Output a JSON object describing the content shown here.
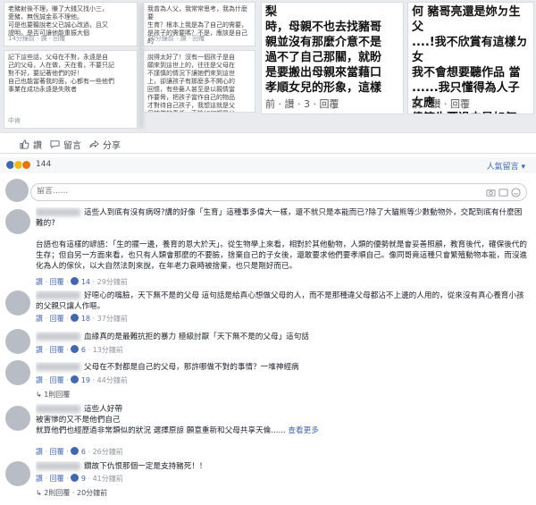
{
  "collage": {
    "tile1": {
      "text": "老豬射後不理，賺了大錢又找小三，\n愛豬，無恆誠金系不理他。\n可是也要聽說老父已誠心改過，且又\n證明，是否可讓他能重振大個",
      "footer": "14分鐘前 · 讚 · 回覆"
    },
    "tile2": {
      "text": "我曾為人父，我常常思考，我為什麼要\n生育？根本上我是為了自己的需要，\n是孩子的需要嗎？不是，應該是自己的\n需要，所以我對上一代的付出，我對我的\n家庭我要負的責任，我擔當著，所以我\n對自己的家庭子女的回報。",
      "footer": "20分鐘前 · 讚 · 回覆"
    },
    "tile3": {
      "text": "梨\n時，母親不也去找豬哥\n親並沒有那麼介意不是\n過不了自己那關，就盼\n是要搬出母親來當藉口\n孝順女兒的形象，這樣",
      "footer": "前 · 讚 · 3 · 回覆"
    },
    "tile4": {
      "text": "何 豬哥亮還是妳ㄉ生父\n....!我不欣賞有這樣ㄉ女\n我不會想要聽作品 當\n......我只懂得為人子女應\n儘管生覆過去是如何~!!",
      "footer": "前 · 讚 · 回覆"
    },
    "tile5": {
      "text": "記下這些話，父母在不對，永遠是自\n己的父母，人在做，天在看，不要只記\n對不好，要記著他們的好！\n自己也能當著我的面，心都有一些他們\n事業在成功永遠是失敗者",
      "footer": "中肯"
    },
    "tile6": {
      "text": "說得太好了！沒有一個孩子是自\n願來到這世上的，往往是父母在\n不謹慎的情況下讓她們來到這世\n上，卻讓孩子有那麼多不開心的\n回憶，有些藝人甚至是以親情當\n作要脅，把孩子當作自己的物品\n才對待自己孩子，我想這就是父\n母該做的責任，不論如何都是父\n母的責任，我們的照顧而懲罰了孩子\n其實事情很簡單。",
      "footer": ""
    }
  },
  "actions": {
    "like": "讚",
    "comment": "留言",
    "share": "分享"
  },
  "reactions": {
    "count": "144",
    "sort_label": "人氣留言"
  },
  "composer": {
    "placeholder": "留言......"
  },
  "comments": [
    {
      "text": "這些人到底有沒有病呀?講的好像「生育」這種事多偉大一樣，還不就只是本能而已?除了大貓熊等少數動物外，交配到底有什麼困難的?\n\n台語也有這樣的諺語：「生的擺一邊，養育的恩大於天」。從生物學上來看，相對於其他動物，人類的優勢就是會妥善照顧，教育後代，確保後代的生存；但自另一方面來看，也只有人類會那麼的不要臉，捨棄自己的子女後，還敢要求他們要孝順自己。像同哥竟這種只會繁殖動物本能，而沒進化為人的傢伙，以大自然法則來說，在年老力衰時被捨棄，也只是剛好而已。",
      "meta": {
        "like": "讚",
        "reply": "回覆",
        "likes": "14",
        "time": "29分鐘前"
      }
    },
    {
      "text": "好噁心的嘴臉，天下無不是的父母 這句話是給真心想做父母的人，而不是那種違父母都沾不上邊的人用的，從來沒有真心養育小孩的父親只讓人作嘔。",
      "meta": {
        "like": "讚",
        "reply": "回覆",
        "likes": "18",
        "time": "37分鐘前"
      }
    },
    {
      "text": "血緣真的是最難抗拒的暴力 極級討厭「天下無不是的父母」這句話",
      "meta": {
        "like": "讚",
        "reply": "回覆",
        "likes": "6",
        "time": "13分鐘前"
      }
    },
    {
      "text": "父母在不對都是自己的父母，那許哪做不對的事情？一堆神經病",
      "meta": {
        "like": "讚",
        "reply": "回覆",
        "likes": "19",
        "time": "44分鐘前"
      },
      "replies": "1則回覆"
    },
    {
      "text": "這些人好帶\n被害慘的又不是他們自己\n就算他們也經歷過非常類似的狀況 選擇原諒 願意重新和父母共享天倫......",
      "more": "查看更多",
      "meta": {
        "like": "讚",
        "reply": "回覆",
        "likes": "6",
        "time": "26分鐘前"
      }
    },
    {
      "text": "鑽故下仇恨那個一定是支持豬死！！",
      "meta": {
        "like": "讚",
        "reply": "回覆",
        "likes": "9",
        "time": "41分鐘前"
      },
      "replies": "2則回覆",
      "replies_time": "20分鐘前"
    }
  ]
}
